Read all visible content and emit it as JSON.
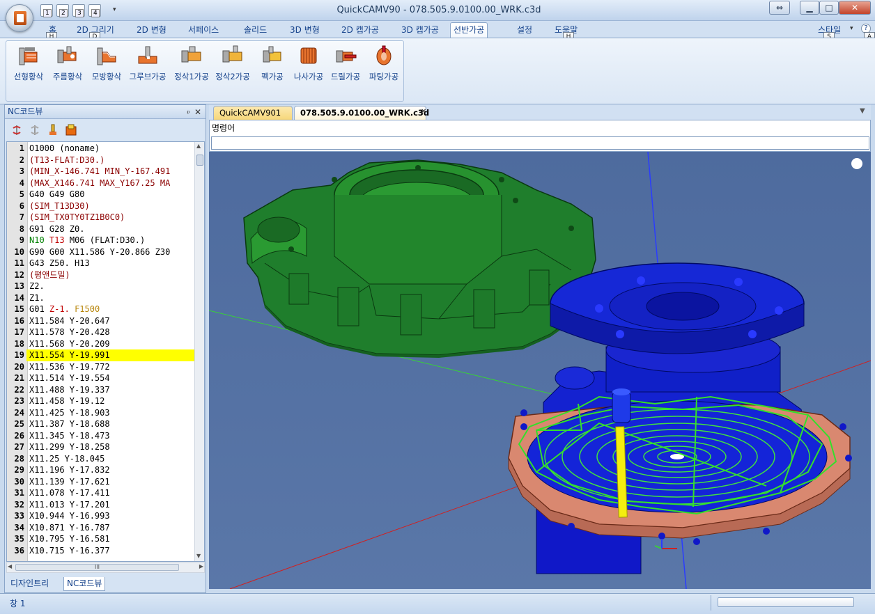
{
  "window": {
    "title": "QuickCAMV90 - 078.505.9.0100.00_WRK.c3d"
  },
  "quick_access": [
    "1",
    "2",
    "3",
    "4"
  ],
  "window_controls": {
    "restore": "⇔",
    "minimize": "▁",
    "maximize": "□",
    "close": "✕"
  },
  "ribbon": {
    "tabs": [
      {
        "label": "홈",
        "keytip": "H"
      },
      {
        "label": "2D 그리기",
        "keytip": "D"
      },
      {
        "label": "2D 변형"
      },
      {
        "label": "서페이스"
      },
      {
        "label": "솔리드"
      },
      {
        "label": "3D 변형"
      },
      {
        "label": "2D 캡가공"
      },
      {
        "label": "3D 캡가공"
      },
      {
        "label": "선반가공",
        "active": true
      },
      {
        "label": "설정"
      },
      {
        "label": "도움말",
        "keytip": "H"
      }
    ],
    "style": {
      "label": "스타일",
      "keytip": "S"
    },
    "help_keytip": "A",
    "buttons": [
      {
        "label": "선형황삭",
        "icon": "linear-roughing-icon"
      },
      {
        "label": "주름황삭",
        "icon": "groove-roughing-icon"
      },
      {
        "label": "모방황삭",
        "icon": "copy-roughing-icon"
      },
      {
        "label": "그루브가공",
        "icon": "groove-machining-icon"
      },
      {
        "label": "정삭1가공",
        "icon": "finishing1-icon"
      },
      {
        "label": "정삭2가공",
        "icon": "finishing2-icon"
      },
      {
        "label": "펙가공",
        "icon": "peck-machining-icon"
      },
      {
        "label": "나사가공",
        "icon": "thread-machining-icon"
      },
      {
        "label": "드릴가공",
        "icon": "drill-machining-icon"
      },
      {
        "label": "파팅가공",
        "icon": "parting-icon"
      }
    ]
  },
  "nc_panel": {
    "title": "NC코드뷰",
    "pin": "ᵖ",
    "close": "✕",
    "bottom_tabs": [
      "디자인트리",
      "NC코드뷰"
    ],
    "hscroll_grip": "III",
    "lines": [
      {
        "n": "1",
        "t": "O1000 (noname)",
        "c": "k"
      },
      {
        "n": "2",
        "t": "(T13-FLAT:D30.)",
        "c": "p"
      },
      {
        "n": "3",
        "t": "(MIN_X-146.741 MIN_Y-167.491",
        "c": "p"
      },
      {
        "n": "4",
        "t": "(MAX_X146.741 MAX_Y167.25 MA",
        "c": "p"
      },
      {
        "n": "5",
        "t": "G40 G49 G80",
        "c": "k"
      },
      {
        "n": "6",
        "t": "(SIM_T13D30)",
        "c": "p"
      },
      {
        "n": "7",
        "t": "(SIM_TX0TY0TZ1B0C0)",
        "c": "p"
      },
      {
        "n": "8",
        "t": "G91 G28 Z0.",
        "c": "k"
      },
      {
        "n": "9",
        "t": "",
        "c": "mix9"
      },
      {
        "n": "10",
        "t": "G90 G00 X11.586 Y-20.866 Z30",
        "c": "k"
      },
      {
        "n": "11",
        "t": "G43 Z50. H13",
        "c": "k"
      },
      {
        "n": "12",
        "t": "(평앤드밀)",
        "c": "p"
      },
      {
        "n": "13",
        "t": "Z2.",
        "c": "k"
      },
      {
        "n": "14",
        "t": "Z1.",
        "c": "k"
      },
      {
        "n": "15",
        "t": "",
        "c": "mix15"
      },
      {
        "n": "16",
        "t": "X11.584 Y-20.647",
        "c": "k"
      },
      {
        "n": "17",
        "t": "X11.578 Y-20.428",
        "c": "k"
      },
      {
        "n": "18",
        "t": "X11.568 Y-20.209",
        "c": "k"
      },
      {
        "n": "19",
        "t": "X11.554 Y-19.991",
        "c": "k",
        "hl": true
      },
      {
        "n": "20",
        "t": "X11.536 Y-19.772",
        "c": "k"
      },
      {
        "n": "21",
        "t": "X11.514 Y-19.554",
        "c": "k"
      },
      {
        "n": "22",
        "t": "X11.488 Y-19.337",
        "c": "k"
      },
      {
        "n": "23",
        "t": "X11.458 Y-19.12",
        "c": "k"
      },
      {
        "n": "24",
        "t": "X11.425 Y-18.903",
        "c": "k"
      },
      {
        "n": "25",
        "t": "X11.387 Y-18.688",
        "c": "k"
      },
      {
        "n": "26",
        "t": "X11.345 Y-18.473",
        "c": "k"
      },
      {
        "n": "27",
        "t": "X11.299 Y-18.258",
        "c": "k"
      },
      {
        "n": "28",
        "t": "X11.25 Y-18.045",
        "c": "k"
      },
      {
        "n": "29",
        "t": "X11.196 Y-17.832",
        "c": "k"
      },
      {
        "n": "30",
        "t": "X11.139 Y-17.621",
        "c": "k"
      },
      {
        "n": "31",
        "t": "X11.078 Y-17.411",
        "c": "k"
      },
      {
        "n": "32",
        "t": "X11.013 Y-17.201",
        "c": "k"
      },
      {
        "n": "33",
        "t": "X10.944 Y-16.993",
        "c": "k"
      },
      {
        "n": "34",
        "t": "X10.871 Y-16.787",
        "c": "k"
      },
      {
        "n": "35",
        "t": "X10.795 Y-16.581",
        "c": "k"
      },
      {
        "n": "36",
        "t": "X10.715 Y-16.377",
        "c": "k"
      }
    ],
    "line9": {
      "a": "N10",
      "b": "T13",
      "c": "M06 (FLAT:D30.)"
    },
    "line15": {
      "a": "G01",
      "b": "Z-1.",
      "c": "F1500"
    }
  },
  "doc_tabs": [
    "QuickCAMV901",
    "078.505.9.0100.00_WRK.c3d"
  ],
  "command": {
    "label": "명령어",
    "value": ""
  },
  "status": {
    "text": "창 1"
  },
  "colors": {
    "green_part": "#1e7a2a",
    "blue_part": "#1018c8",
    "stock": "#d98870",
    "toolpath": "#33e02a",
    "tool": "#f4ee10"
  }
}
